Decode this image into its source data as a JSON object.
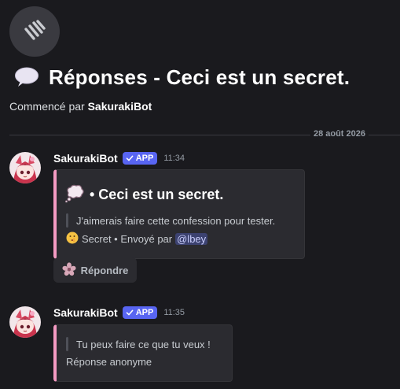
{
  "thread": {
    "title": "Réponses - Ceci est un secret.",
    "started_by_prefix": "Commencé par",
    "started_by_user": "SakurakiBot"
  },
  "divider": {
    "date": "28 août 2026"
  },
  "messages": [
    {
      "author": "SakurakiBot",
      "badge": "APP",
      "time": "11:34",
      "embed": {
        "title": "• Ceci est un secret.",
        "quote": "J'aimerais faire cette confession pour tester.",
        "footer_label": "Secret • Envoyé par",
        "mention": "@lbey"
      },
      "button_label": "Répondre"
    },
    {
      "author": "SakurakiBot",
      "badge": "APP",
      "time": "11:35",
      "embed": {
        "quote": "Tu peux faire ce que tu veux !",
        "footer_text": "Réponse anonyme"
      }
    }
  ],
  "colors": {
    "background": "#1a1a1e",
    "embed_accent": "#f49ac2",
    "badge": "#5865f2",
    "mention_bg": "#3c4270"
  },
  "icons": {
    "thread": "thread-icon",
    "title_emoji": "speech-balloon-icon",
    "embed_emoji": "thought-balloon-icon",
    "footer_emoji": "shushing-face-icon",
    "button": "sakura-flower-icon",
    "badge_check": "checkmark-icon"
  }
}
